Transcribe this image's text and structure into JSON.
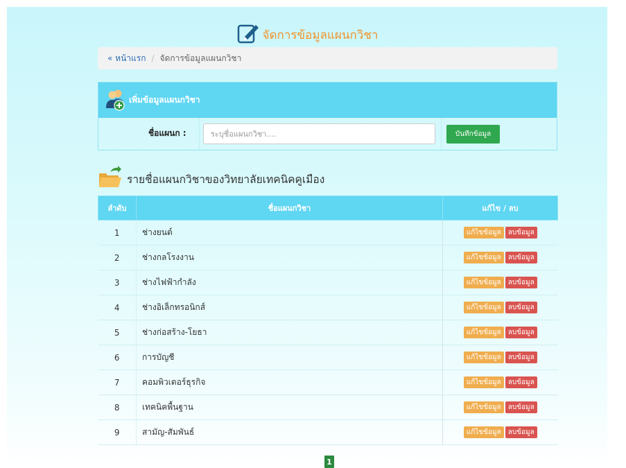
{
  "header": {
    "title": "จัดการข้อมูลแผนกวิชา",
    "icon": "edit-icon"
  },
  "breadcrumb": {
    "home": "« หน้าแรก",
    "separator": "/",
    "current": "จัดการข้อมูลแผนกวิชา"
  },
  "add_panel": {
    "title": "เพิ่มข้อมูลแผนกวิชา",
    "icon": "users-add-icon",
    "label": "ชื่อแผนก :",
    "placeholder": "ระบุชื่อแผนกวิชา....",
    "value": "",
    "save_label": "บันทึกข้อมูล"
  },
  "list": {
    "title": "รายชื่อแผนกวิชาของวิทยาลัยเทคนิคคูเมือง",
    "icon": "folder-open-icon",
    "columns": [
      "ลำดับ",
      "ชื่อแผนกวิชา",
      "แก้ไข / ลบ"
    ],
    "rows": [
      {
        "no": "1",
        "name": "ช่างยนต์"
      },
      {
        "no": "2",
        "name": "ช่างกลโรงงาน"
      },
      {
        "no": "3",
        "name": "ช่างไฟฟ้ากำลัง"
      },
      {
        "no": "4",
        "name": "ช่างอิเล็กทรอนิกส์"
      },
      {
        "no": "5",
        "name": "ช่างก่อสร้าง-โยธา"
      },
      {
        "no": "6",
        "name": "การบัญชี"
      },
      {
        "no": "7",
        "name": "คอมพิวเตอร์ธุรกิจ"
      },
      {
        "no": "8",
        "name": "เทคนิคพื้นฐาน"
      },
      {
        "no": "9",
        "name": "สามัญ-สัมพันธ์"
      }
    ],
    "edit_label": "แก้ไขข้อมูล",
    "delete_label": "ลบข้อมูล"
  },
  "pagination": {
    "current": "1"
  },
  "colors": {
    "accent": "#5fd6f2",
    "title": "#f0932b",
    "save": "#2fa84f",
    "edit": "#f0ad4e",
    "delete": "#d9534f",
    "pager": "#2b8a3e"
  }
}
